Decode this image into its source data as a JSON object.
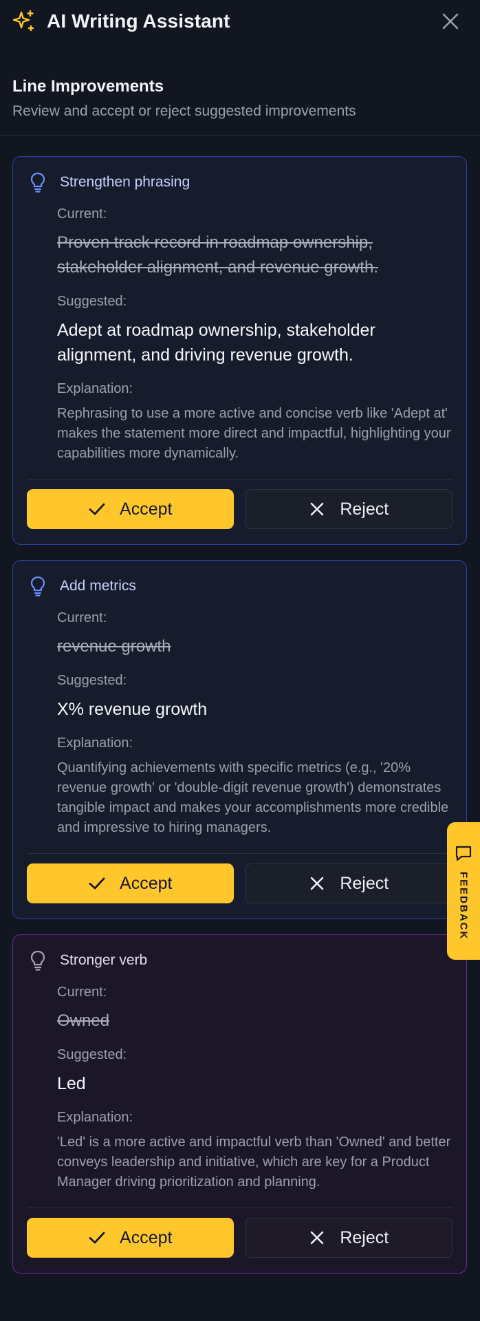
{
  "header": {
    "title": "AI Writing Assistant",
    "icon": "sparkle-icon",
    "close_icon": "close-icon"
  },
  "section": {
    "title": "Line Improvements",
    "subtitle": "Review and accept or reject suggested improvements"
  },
  "labels": {
    "current": "Current:",
    "suggested": "Suggested:",
    "explanation": "Explanation:",
    "accept": "Accept",
    "reject": "Reject"
  },
  "cards": [
    {
      "title": "Strengthen phrasing",
      "current": "Proven track record in roadmap ownership, stakeholder alignment, and revenue growth.",
      "suggested": "Adept at roadmap ownership, stakeholder alignment, and driving revenue growth.",
      "explanation": "Rephrasing to use a more active and concise verb like 'Adept at' makes the statement more direct and impactful, highlighting your capabilities more dynamically."
    },
    {
      "title": "Add metrics",
      "current": "revenue growth",
      "suggested": "X% revenue growth",
      "explanation": "Quantifying achievements with specific metrics (e.g., '20% revenue growth' or 'double-digit revenue growth') demonstrates tangible impact and makes your accomplishments more credible and impressive to hiring managers."
    },
    {
      "title": "Stronger verb",
      "current": "Owned",
      "suggested": "Led",
      "explanation": "'Led' is a more active and impactful verb than 'Owned' and better conveys leadership and initiative, which are key for a Product Manager driving prioritization and planning."
    }
  ],
  "feedback": {
    "label": "FEEDBACK"
  },
  "colors": {
    "accent": "#ffc72c",
    "card_border_blue": "#2d3fa8",
    "card_border_purple": "#6b2b9e",
    "bulb_blue": "#6f8fff"
  }
}
